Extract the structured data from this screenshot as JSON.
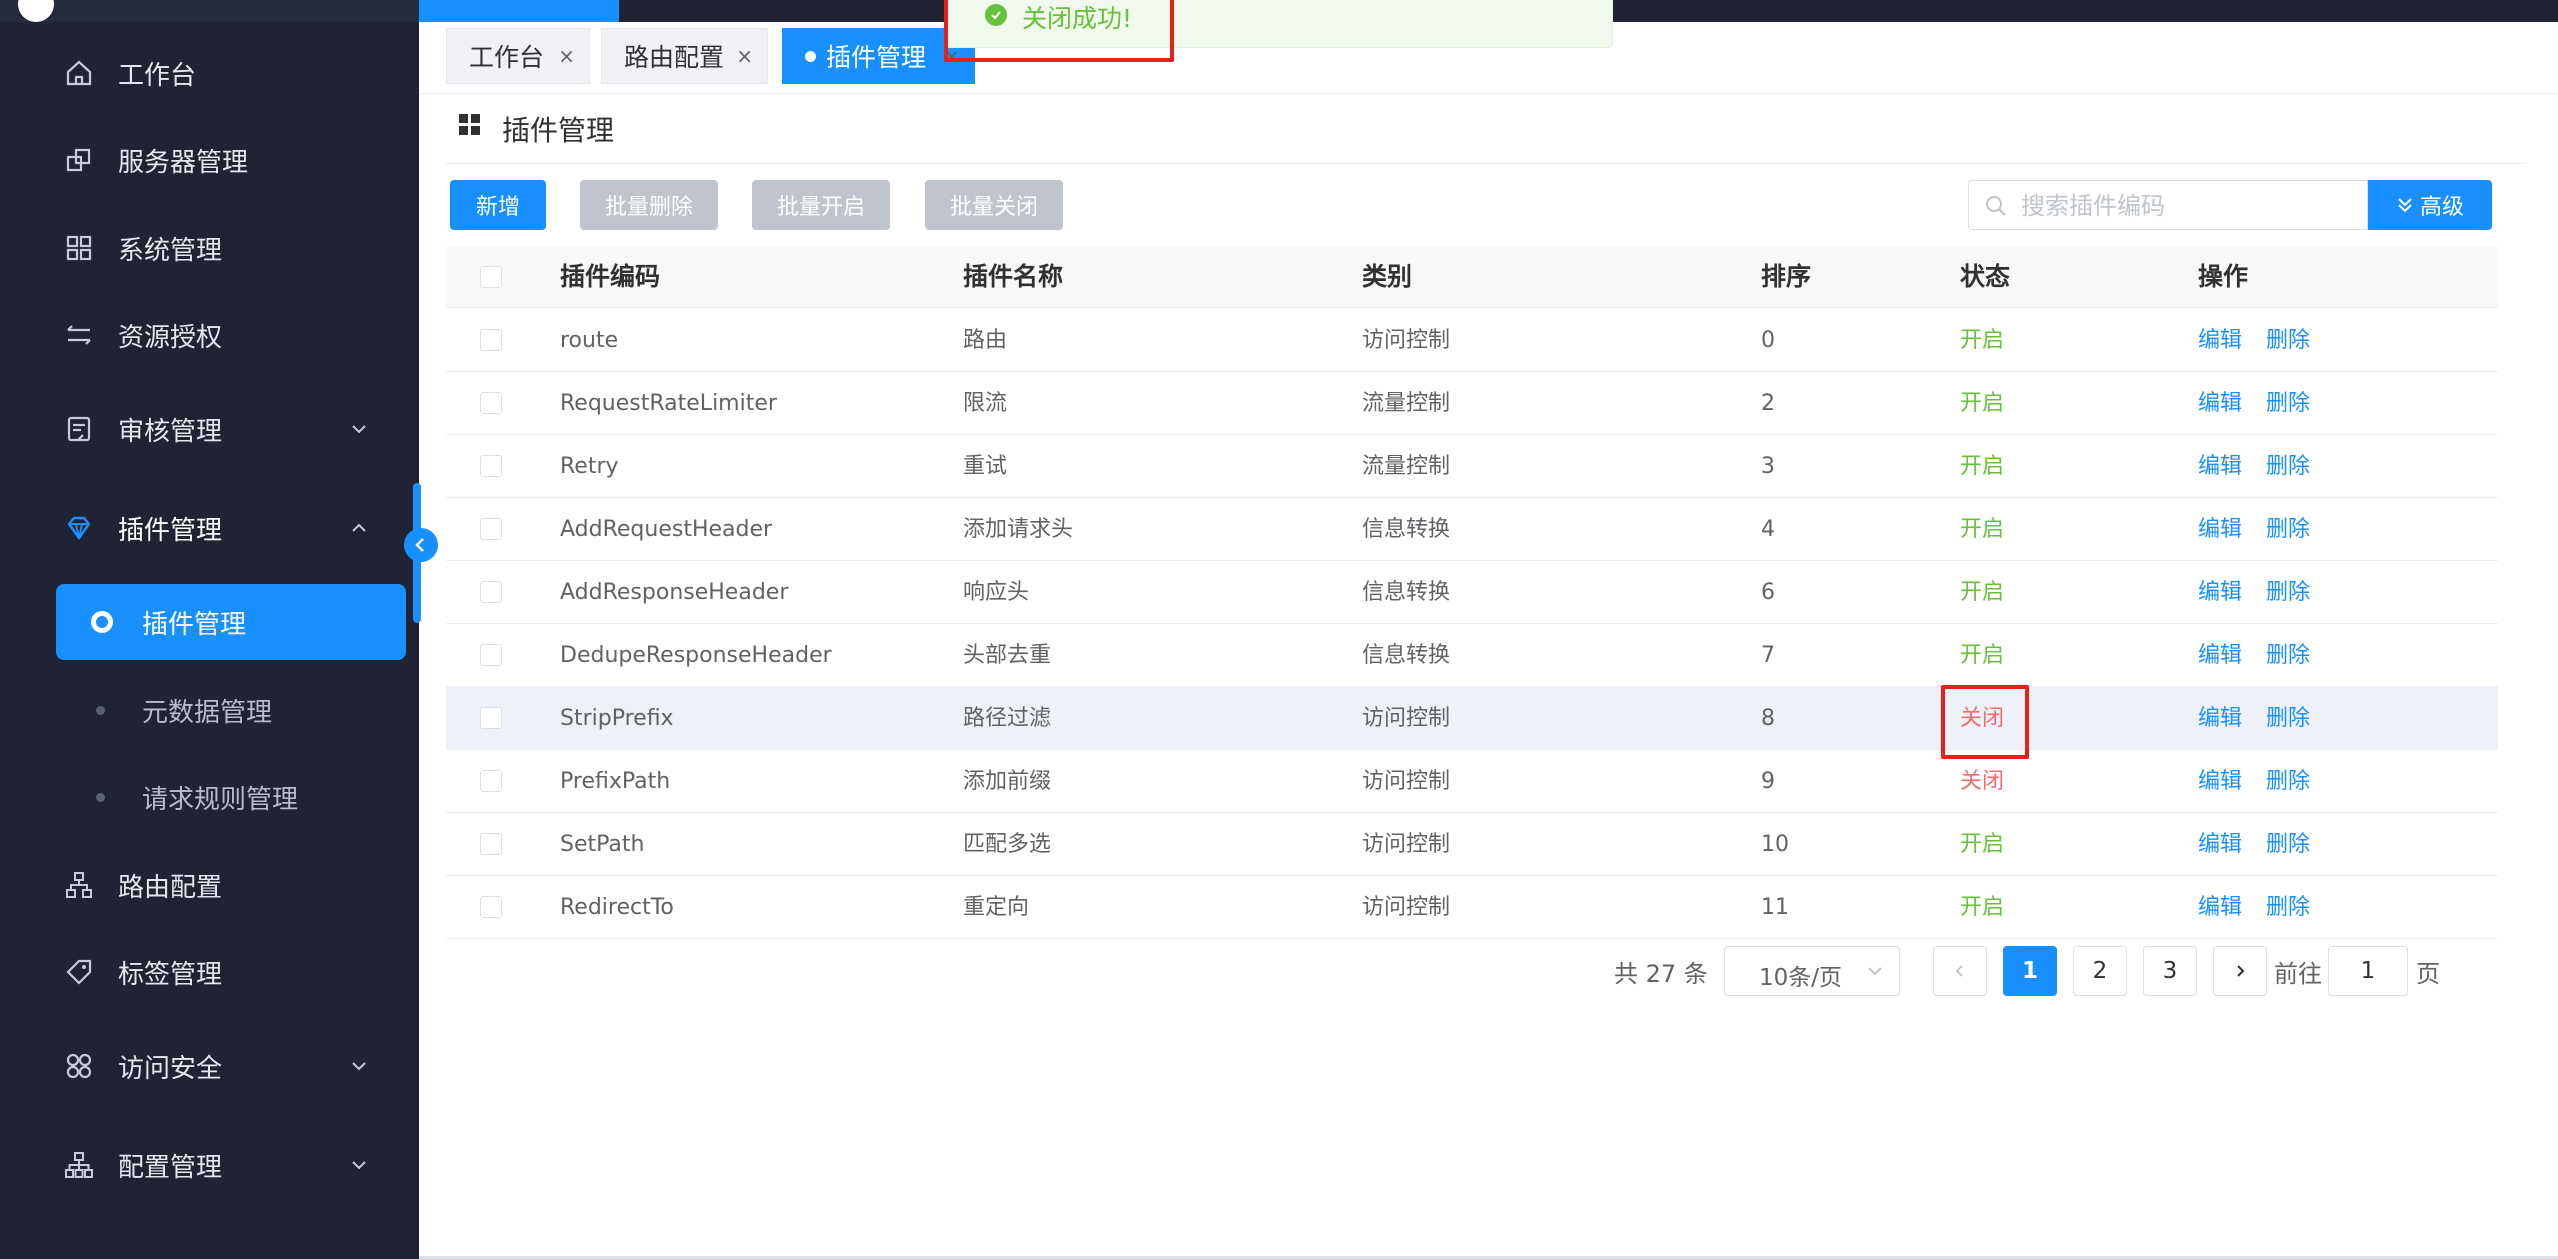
{
  "sidebar": {
    "items": [
      {
        "label": "工作台",
        "icon": "home-icon"
      },
      {
        "label": "服务器管理",
        "icon": "server-icon"
      },
      {
        "label": "系统管理",
        "icon": "grid-icon"
      },
      {
        "label": "资源授权",
        "icon": "transfer-icon"
      },
      {
        "label": "审核管理",
        "icon": "audit-icon"
      },
      {
        "label": "插件管理",
        "icon": "diamond-icon"
      },
      {
        "label": "路由配置",
        "icon": "route-icon"
      },
      {
        "label": "标签管理",
        "icon": "tag-icon"
      },
      {
        "label": "访问安全",
        "icon": "security-icon"
      },
      {
        "label": "配置管理",
        "icon": "config-icon"
      }
    ],
    "plugin_sub": [
      {
        "label": "插件管理"
      },
      {
        "label": "元数据管理"
      },
      {
        "label": "请求规则管理"
      }
    ],
    "accent_color": "#1890ff",
    "background": "#1f2333"
  },
  "tabs": [
    {
      "label": "工作台",
      "close": "×"
    },
    {
      "label": "路由配置",
      "close": "×"
    },
    {
      "label": "插件管理",
      "close": "×"
    }
  ],
  "toast": {
    "text": "关闭成功!"
  },
  "page": {
    "title": "插件管理"
  },
  "toolbar": {
    "add": "新增",
    "batch_delete": "批量删除",
    "batch_enable": "批量开启",
    "batch_disable": "批量关闭",
    "search_placeholder": "搜索插件编码",
    "advanced": "高级"
  },
  "table": {
    "headers": [
      "插件编码",
      "插件名称",
      "类别",
      "排序",
      "状态",
      "操作"
    ],
    "rows": [
      {
        "code": "route",
        "name": "路由",
        "category": "访问控制",
        "sort": "0",
        "status": "开启",
        "on": true
      },
      {
        "code": "RequestRateLimiter",
        "name": "限流",
        "category": "流量控制",
        "sort": "2",
        "status": "开启",
        "on": true
      },
      {
        "code": "Retry",
        "name": "重试",
        "category": "流量控制",
        "sort": "3",
        "status": "开启",
        "on": true
      },
      {
        "code": "AddRequestHeader",
        "name": "添加请求头",
        "category": "信息转换",
        "sort": "4",
        "status": "开启",
        "on": true
      },
      {
        "code": "AddResponseHeader",
        "name": "响应头",
        "category": "信息转换",
        "sort": "6",
        "status": "开启",
        "on": true
      },
      {
        "code": "DedupeResponseHeader",
        "name": "头部去重",
        "category": "信息转换",
        "sort": "7",
        "status": "开启",
        "on": true
      },
      {
        "code": "StripPrefix",
        "name": "路径过滤",
        "category": "访问控制",
        "sort": "8",
        "status": "关闭",
        "on": false
      },
      {
        "code": "PrefixPath",
        "name": "添加前缀",
        "category": "访问控制",
        "sort": "9",
        "status": "关闭",
        "on": false
      },
      {
        "code": "SetPath",
        "name": "匹配多选",
        "category": "访问控制",
        "sort": "10",
        "status": "开启",
        "on": true
      },
      {
        "code": "RedirectTo",
        "name": "重定向",
        "category": "访问控制",
        "sort": "11",
        "status": "开启",
        "on": true
      }
    ],
    "edit": "编辑",
    "delete": "删除"
  },
  "pagination": {
    "total": "共 27 条",
    "page_size": "10条/页",
    "pages": [
      "1",
      "2",
      "3"
    ],
    "current": "1",
    "goto_prefix": "前往",
    "goto_value": "1",
    "goto_suffix": "页"
  },
  "colors": {
    "on": "#67c23a",
    "off": "#f56c6c",
    "primary": "#1890ff",
    "highlight": "#e62117"
  }
}
